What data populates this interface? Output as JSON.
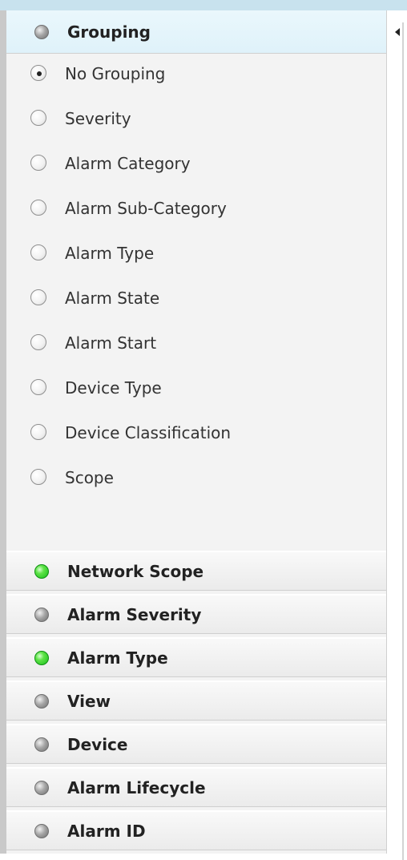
{
  "panel": {
    "grouping": {
      "title": "Grouping",
      "selected": "No Grouping",
      "options": [
        "No Grouping",
        "Severity",
        "Alarm Category",
        "Alarm Sub-Category",
        "Alarm Type",
        "Alarm State",
        "Alarm Start",
        "Device Type",
        "Device Classification",
        "Scope"
      ]
    },
    "sections": [
      {
        "label": "Network Scope",
        "status": "active",
        "icon": "green-status-icon"
      },
      {
        "label": "Alarm Severity",
        "status": "inactive",
        "icon": "gray-status-icon"
      },
      {
        "label": "Alarm Type",
        "status": "active",
        "icon": "green-status-icon"
      },
      {
        "label": "View",
        "status": "inactive",
        "icon": "gray-status-icon"
      },
      {
        "label": "Device",
        "status": "inactive",
        "icon": "gray-status-icon"
      },
      {
        "label": "Alarm Lifecycle",
        "status": "inactive",
        "icon": "gray-status-icon"
      },
      {
        "label": "Alarm ID",
        "status": "inactive",
        "icon": "gray-status-icon"
      }
    ],
    "colors": {
      "active_status": "#17bf1b",
      "inactive_status": "#8f8f8f",
      "header_highlight": "#dff2fa"
    },
    "icons": {
      "collapse": "left-arrow-icon"
    }
  }
}
